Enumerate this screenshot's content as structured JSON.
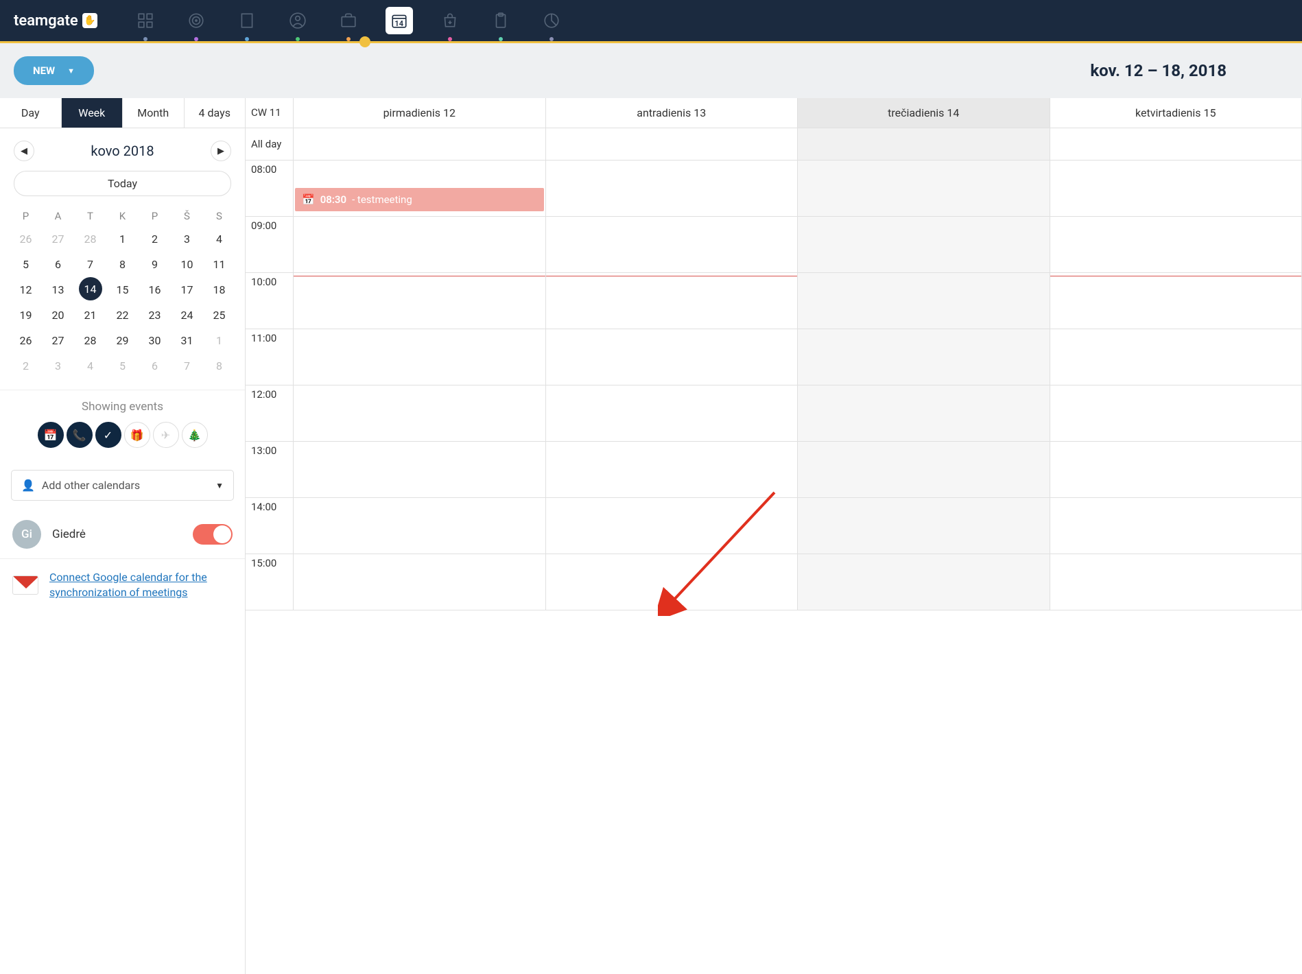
{
  "brand": "teamgate",
  "nav": {
    "calendar_day": "14",
    "dots": [
      "#7a8fb3",
      "#b36fe0",
      "#5fa4d8",
      "#4ec777",
      "#f0a050",
      "",
      "#e65fa4",
      "#5fd0b0",
      "#8a8fb3"
    ]
  },
  "header": {
    "new_label": "NEW",
    "date_range": "kov. 12 – 18, 2018"
  },
  "view_tabs": [
    "Day",
    "Week",
    "Month",
    "4 days"
  ],
  "active_view": "Week",
  "month_nav": {
    "label": "kovo 2018",
    "today": "Today"
  },
  "weekdays": [
    "P",
    "A",
    "T",
    "K",
    "P",
    "Š",
    "S"
  ],
  "mini_days": [
    {
      "d": "26",
      "m": true
    },
    {
      "d": "27",
      "m": true
    },
    {
      "d": "28",
      "m": true
    },
    {
      "d": "1"
    },
    {
      "d": "2"
    },
    {
      "d": "3"
    },
    {
      "d": "4"
    },
    {
      "d": "5"
    },
    {
      "d": "6"
    },
    {
      "d": "7"
    },
    {
      "d": "8"
    },
    {
      "d": "9"
    },
    {
      "d": "10"
    },
    {
      "d": "11"
    },
    {
      "d": "12"
    },
    {
      "d": "13"
    },
    {
      "d": "14",
      "t": true
    },
    {
      "d": "15"
    },
    {
      "d": "16"
    },
    {
      "d": "17"
    },
    {
      "d": "18"
    },
    {
      "d": "19"
    },
    {
      "d": "20"
    },
    {
      "d": "21"
    },
    {
      "d": "22"
    },
    {
      "d": "23"
    },
    {
      "d": "24"
    },
    {
      "d": "25"
    },
    {
      "d": "26"
    },
    {
      "d": "27"
    },
    {
      "d": "28"
    },
    {
      "d": "29"
    },
    {
      "d": "30"
    },
    {
      "d": "31"
    },
    {
      "d": "1",
      "m": true
    },
    {
      "d": "2",
      "m": true
    },
    {
      "d": "3",
      "m": true
    },
    {
      "d": "4",
      "m": true
    },
    {
      "d": "5",
      "m": true
    },
    {
      "d": "6",
      "m": true
    },
    {
      "d": "7",
      "m": true
    },
    {
      "d": "8",
      "m": true
    }
  ],
  "showing_label": "Showing events",
  "add_calendars": "Add other calendars",
  "user": {
    "initials": "Gi",
    "name": "Giedrė"
  },
  "google_link": "Connect Google calendar for the synchronization of meetings",
  "cal": {
    "cw": "CW 11",
    "allday": "All day",
    "days": [
      {
        "label": "pirmadienis 12",
        "today": false
      },
      {
        "label": "antradienis 13",
        "today": false
      },
      {
        "label": "trečiadienis 14",
        "today": true
      },
      {
        "label": "ketvirtadienis 15",
        "today": false
      }
    ],
    "hours": [
      "08:00",
      "09:00",
      "10:00",
      "11:00",
      "12:00",
      "13:00",
      "14:00",
      "15:00"
    ],
    "event": {
      "time": "08:30",
      "title": "testmeeting"
    }
  }
}
